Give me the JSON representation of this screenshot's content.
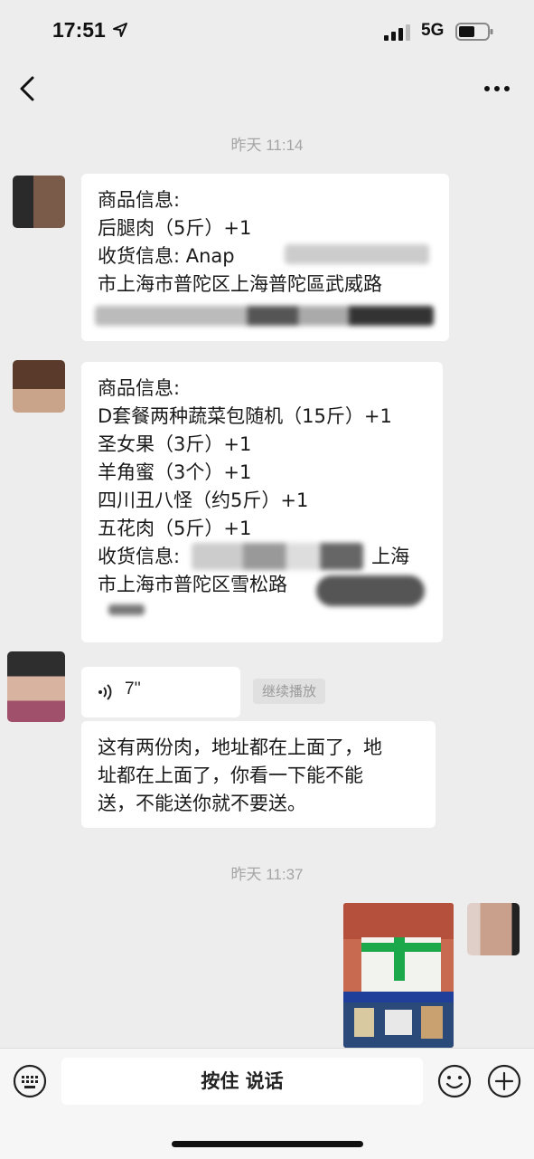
{
  "status": {
    "time": "17:51",
    "network": "5G"
  },
  "chat": {
    "timestamp_1": "昨天 11:14",
    "timestamp_2": "昨天 11:37",
    "msg1": [
      "商品信息:",
      "后腿肉（5斤）+1",
      "收货信息: Anap",
      "市上海市普陀区上海普陀區武威路"
    ],
    "msg2": [
      "商品信息:",
      "D套餐两种蔬菜包随机（15斤）+1",
      "圣女果（3斤）+1",
      "羊角蜜（3个）+1",
      "四川丑八怪（约5斤）+1",
      "五花肉（5斤）+1",
      "收货信息:",
      "上海",
      "市上海市普陀区雪松路"
    ],
    "voice": {
      "duration": "7''",
      "continue_label": "继续播放"
    },
    "msg3": [
      "这有两份肉，地址都在上面了，地",
      "址都在上面了，你看一下能不能",
      "送，不能送你就不要送。"
    ]
  },
  "inputbar": {
    "hold_to_talk": "按住 说话"
  }
}
